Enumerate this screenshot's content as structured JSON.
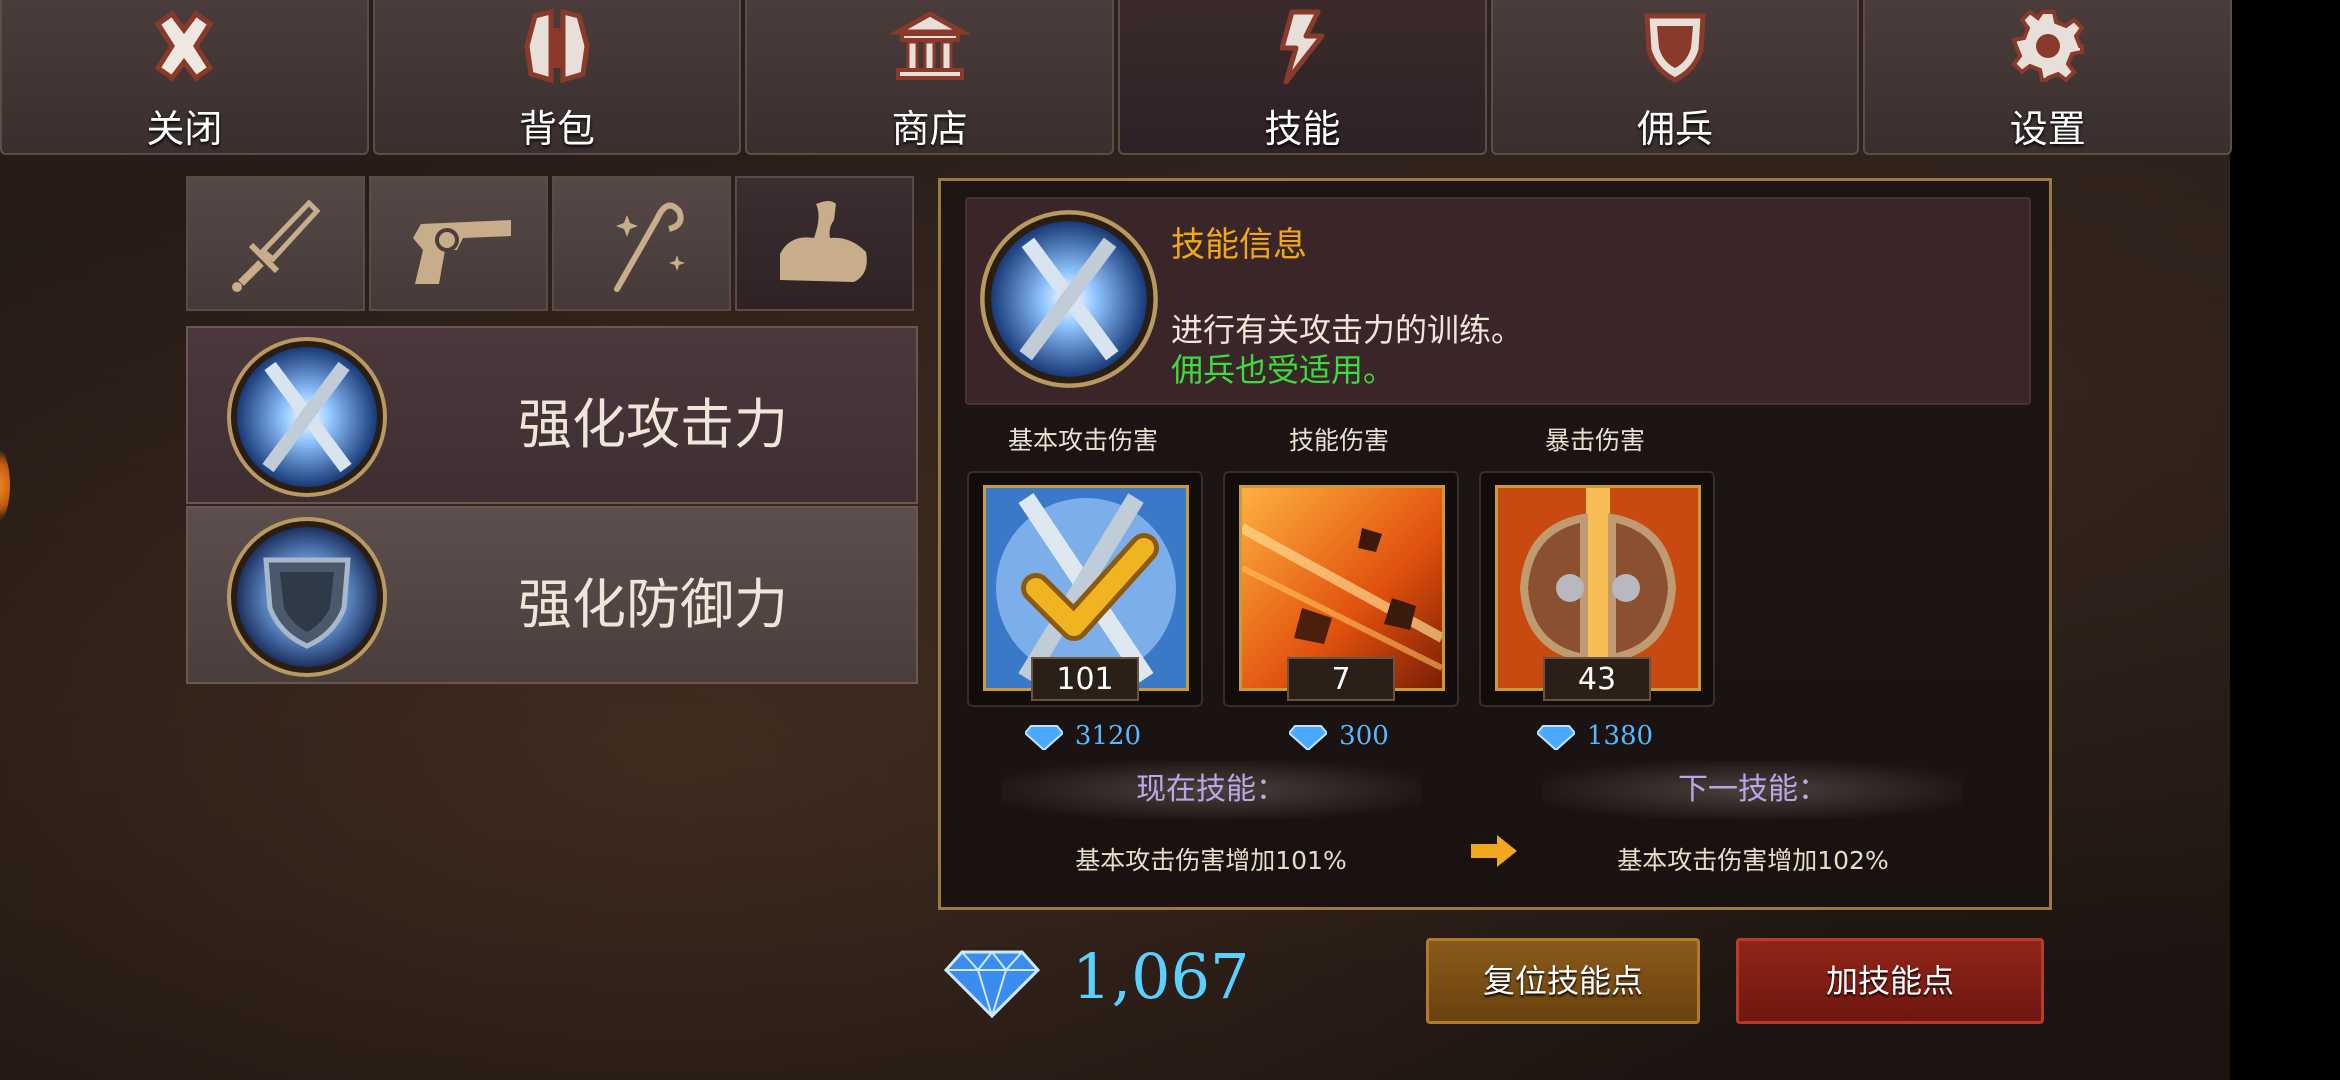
{
  "tabs": [
    {
      "label": "关闭",
      "icon": "close-icon"
    },
    {
      "label": "背包",
      "icon": "backpack-icon"
    },
    {
      "label": "商店",
      "icon": "shop-icon"
    },
    {
      "label": "技能",
      "icon": "lightning-icon",
      "active": true
    },
    {
      "label": "佣兵",
      "icon": "shield-icon"
    },
    {
      "label": "设置",
      "icon": "gear-icon"
    }
  ],
  "class_filters": [
    {
      "icon": "sword-icon"
    },
    {
      "icon": "revolver-icon"
    },
    {
      "icon": "magic-staff-icon"
    },
    {
      "icon": "muscle-arm-icon",
      "active": true
    }
  ],
  "skills": [
    {
      "name": "强化攻击力",
      "icon": "crossed-blades-icon",
      "selected": true
    },
    {
      "name": "强化防御力",
      "icon": "shield-emblem-icon"
    }
  ],
  "info": {
    "title": "技能信息",
    "description": "进行有关攻击力的训练。",
    "note": "佣兵也受适用。",
    "columns": [
      {
        "label": "基本攻击伤害",
        "value": "101",
        "cost": "3120",
        "icon": "crossed-blades-check-icon"
      },
      {
        "label": "技能伤害",
        "value": "7",
        "cost": "300",
        "icon": "fire-burst-icon"
      },
      {
        "label": "暴击伤害",
        "value": "43",
        "cost": "1380",
        "icon": "split-shield-icon"
      }
    ],
    "current_header": "现在技能：",
    "next_header": "下一技能：",
    "current_effect": "基本攻击伤害增加101%",
    "next_effect": "基本攻击伤害增加102%"
  },
  "gem_count": "1,067",
  "buttons": {
    "reset": "复位技能点",
    "add": "加技能点"
  },
  "colors": {
    "gem": "#5ad0ff",
    "title": "#f0a818",
    "note": "#3cdc3c",
    "header": "#b9a8e8",
    "reset_btn": "#7a4e14",
    "add_btn": "#801e14"
  }
}
